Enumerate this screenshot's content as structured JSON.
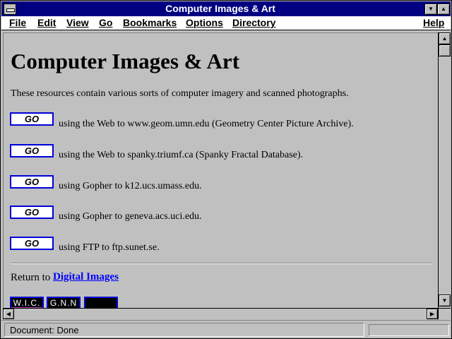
{
  "window": {
    "title": "Computer Images & Art"
  },
  "menu": {
    "items": [
      "File",
      "Edit",
      "View",
      "Go",
      "Bookmarks",
      "Options",
      "Directory"
    ],
    "help": "Help"
  },
  "page": {
    "title": "Computer Images & Art",
    "intro": "These resources contain various sorts of computer imagery and scanned photographs.",
    "go_label": "GO",
    "resources": [
      "using the Web to www.geom.umn.edu (Geometry Center Picture Archive).",
      "using the Web to spanky.triumf.ca (Spanky Fractal Database).",
      "using Gopher to k12.ucs.umass.edu.",
      "using Gopher to geneva.acs.uci.edu.",
      "using FTP to ftp.sunet.se."
    ],
    "return_label": "Return to",
    "return_link": "Digital Images",
    "logos": [
      "W.I.C.",
      "G.N.N",
      ""
    ]
  },
  "status": {
    "text": "Document: Done"
  },
  "colors": {
    "titlebar": "#000080",
    "link": "#0000ff",
    "button_border": "#0000d8",
    "background": "#c0c0c0"
  }
}
